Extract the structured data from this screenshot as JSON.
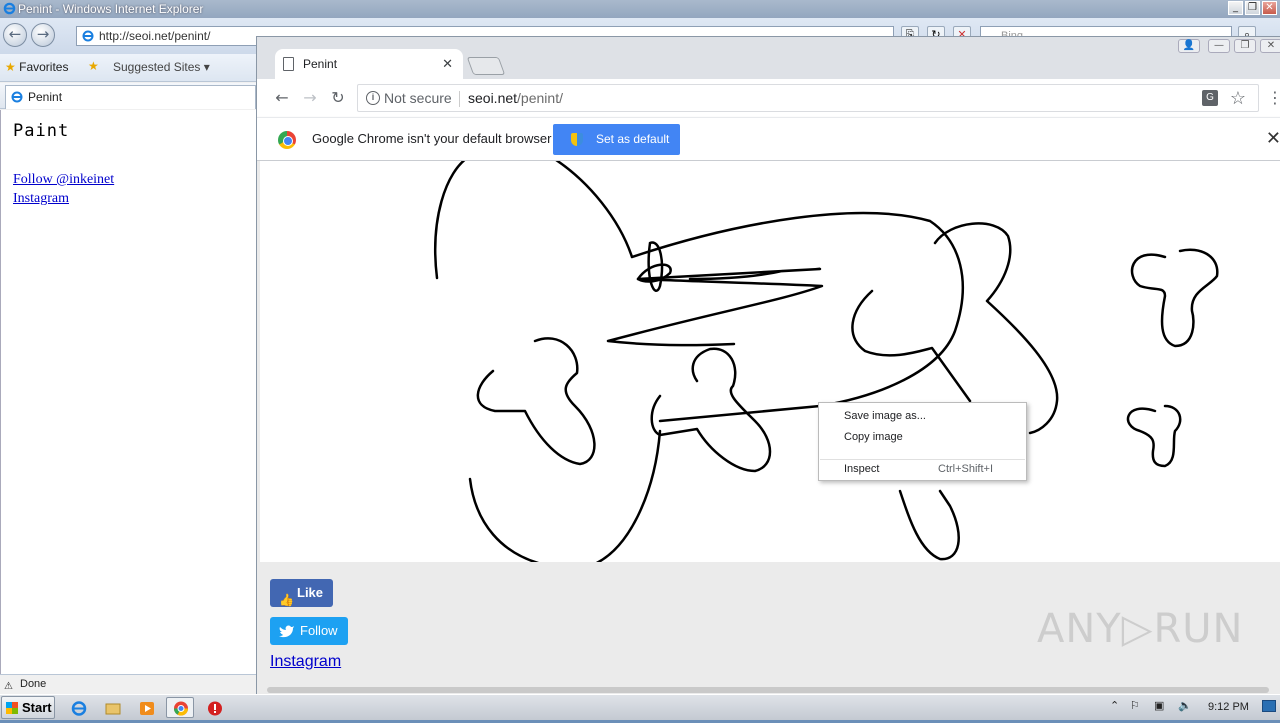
{
  "ie": {
    "window_title": "Penint - Windows Internet Explorer",
    "address": "http://seoi.net/penint/",
    "search_placeholder": "Bing",
    "favorites_label": "Favorites",
    "suggested_sites_label": "Suggested Sites ▾",
    "tab_label": "Penint",
    "page_title": "Paint",
    "links": [
      "Follow @inkeinet",
      "Instagram"
    ],
    "status": "Done"
  },
  "chrome": {
    "tab_label": "Penint",
    "not_secure": "Not secure",
    "url_host": "seoi.net",
    "url_path": "/penint/",
    "infobar_message": "Google Chrome isn't your default browser",
    "set_default_label": "Set as default",
    "fb_like_label": "Like",
    "tw_follow_label": "Follow",
    "instagram_label": "Instagram",
    "context_menu": {
      "save_image": "Save image as...",
      "copy_image": "Copy image",
      "inspect": "Inspect",
      "inspect_shortcut": "Ctrl+Shift+I"
    }
  },
  "watermark": "ANY▷RUN",
  "taskbar": {
    "start_label": "Start",
    "clock": "9:12 PM"
  },
  "colors": {
    "fb_blue": "#4267b2",
    "twitter_blue": "#1da1f2",
    "chrome_blue": "#4285f4",
    "link_blue": "#0000cc"
  }
}
